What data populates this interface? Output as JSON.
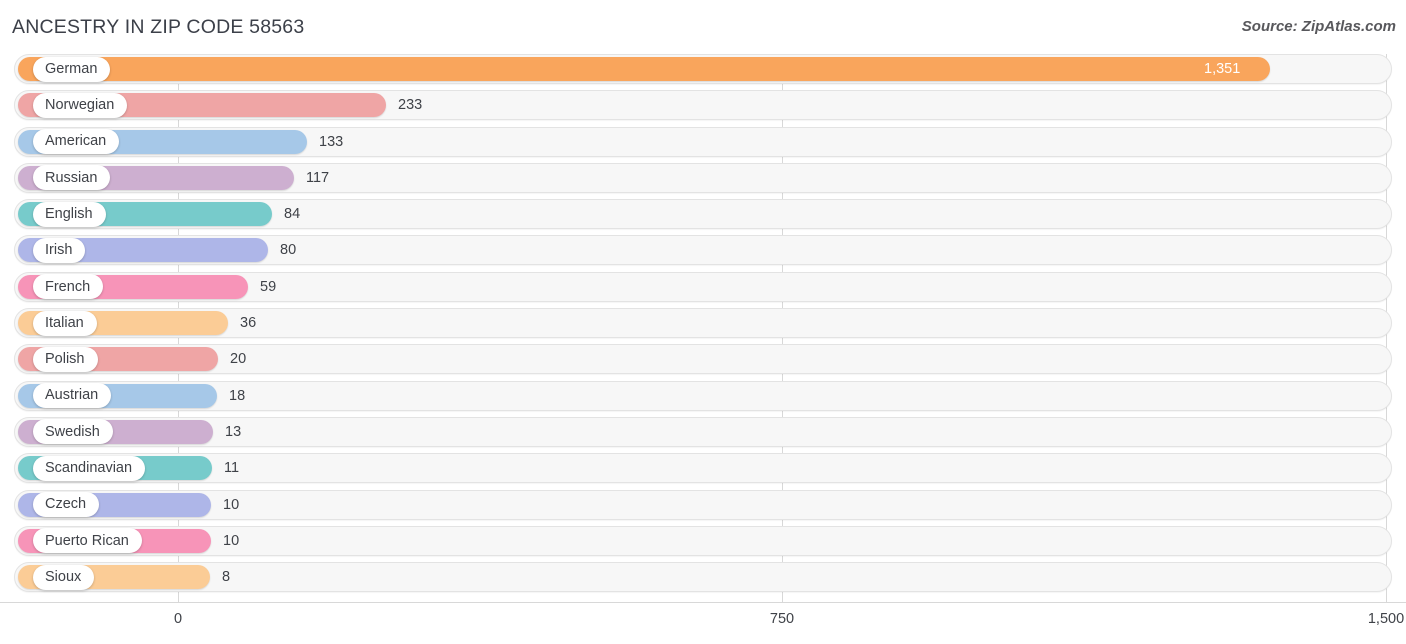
{
  "header": {
    "title": "ANCESTRY IN ZIP CODE 58563",
    "source": "Source: ZipAtlas.com"
  },
  "chart_data": {
    "type": "bar",
    "orientation": "horizontal",
    "title": "ANCESTRY IN ZIP CODE 58563",
    "xlabel": "",
    "ylabel": "",
    "xlim": [
      0,
      1500
    ],
    "grid": true,
    "legend": "none",
    "axis_ticks": [
      "0",
      "750",
      "1,500"
    ],
    "axis_tick_values": [
      0,
      750,
      1500
    ],
    "categories": [
      "German",
      "Norwegian",
      "American",
      "Russian",
      "English",
      "Irish",
      "French",
      "Italian",
      "Polish",
      "Austrian",
      "Swedish",
      "Scandinavian",
      "Czech",
      "Puerto Rican",
      "Sioux"
    ],
    "values": [
      1351,
      233,
      133,
      117,
      84,
      80,
      59,
      36,
      20,
      18,
      13,
      11,
      10,
      10,
      8
    ],
    "value_labels": [
      "1,351",
      "233",
      "133",
      "117",
      "84",
      "80",
      "59",
      "36",
      "20",
      "18",
      "13",
      "11",
      "10",
      "10",
      "8"
    ],
    "bar_colors": [
      "#F9A55C",
      "#EFA5A5",
      "#A6C8E8",
      "#CDAFD0",
      "#77CBCB",
      "#AEB6E8",
      "#F794B8",
      "#FBCC96",
      "#EFA5A5",
      "#A6C8E8",
      "#CDAFD0",
      "#77CBCB",
      "#AEB6E8",
      "#F794B8",
      "#FBCC96"
    ],
    "bar_pixel_ends": [
      1270,
      386,
      307,
      294,
      272,
      268,
      248,
      228,
      218,
      217,
      213,
      212,
      211,
      211,
      210
    ],
    "value_label_inside": [
      true,
      false,
      false,
      false,
      false,
      false,
      false,
      false,
      false,
      false,
      false,
      false,
      false,
      false,
      false
    ]
  },
  "colors": {
    "track_fill": "#F7F7F7",
    "track_border": "#E3E3E3",
    "gridline": "#D8D8D8",
    "text": "#3F4248",
    "title_text": "#3C4049",
    "pill_bg": "#FFFFFF"
  }
}
